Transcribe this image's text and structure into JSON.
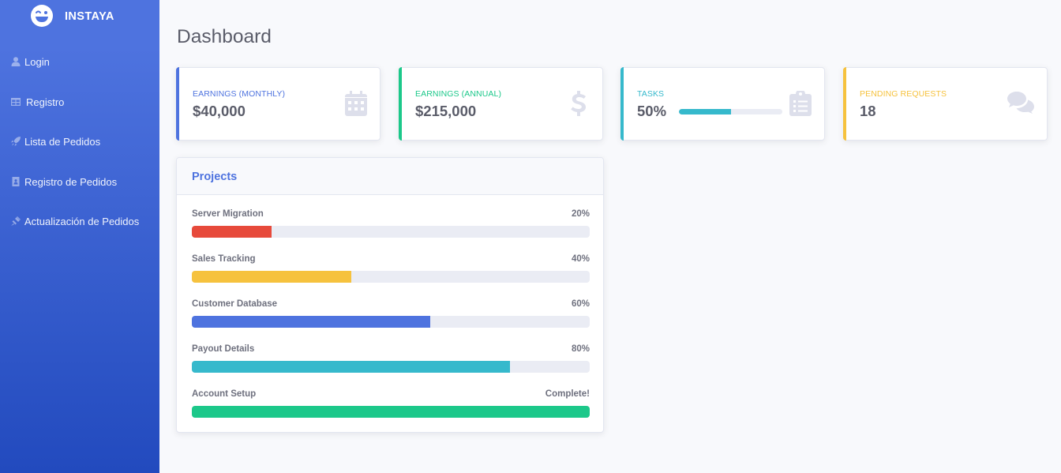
{
  "brand": {
    "name": "INSTAYA"
  },
  "sidebar": {
    "items": [
      {
        "label": "Login",
        "icon": "user-icon"
      },
      {
        "label": "Registro",
        "icon": "table-icon"
      },
      {
        "label": "Lista de Pedidos",
        "icon": "rocket-icon"
      },
      {
        "label": "Registro de Pedidos",
        "icon": "address-book-icon"
      },
      {
        "label": "Actualización de Pedidos",
        "icon": "satellite-icon"
      }
    ]
  },
  "page": {
    "title": "Dashboard"
  },
  "cards": [
    {
      "label": "Earnings (Monthly)",
      "value": "$40,000",
      "color": "#4e73df",
      "icon": "calendar-icon"
    },
    {
      "label": "Earnings (Annual)",
      "value": "$215,000",
      "color": "#1cc88a",
      "icon": "dollar-icon"
    },
    {
      "label": "Tasks",
      "value": "50%",
      "progress": 0.5,
      "color": "#36b9cc",
      "icon": "clipboard-list-icon"
    },
    {
      "label": "Pending Requests",
      "value": "18",
      "color": "#f6c23e",
      "icon": "comments-icon"
    }
  ],
  "projects": {
    "title": "Projects",
    "items": [
      {
        "name": "Server Migration",
        "status": "20%",
        "progress": 0.2,
        "color": "#e74a3b"
      },
      {
        "name": "Sales Tracking",
        "status": "40%",
        "progress": 0.4,
        "color": "#f6c23e"
      },
      {
        "name": "Customer Database",
        "status": "60%",
        "progress": 0.6,
        "color": "#4e73df"
      },
      {
        "name": "Payout Details",
        "status": "80%",
        "progress": 0.8,
        "color": "#36b9cc"
      },
      {
        "name": "Account Setup",
        "status": "Complete!",
        "progress": 1.0,
        "color": "#1cc88a"
      }
    ]
  }
}
